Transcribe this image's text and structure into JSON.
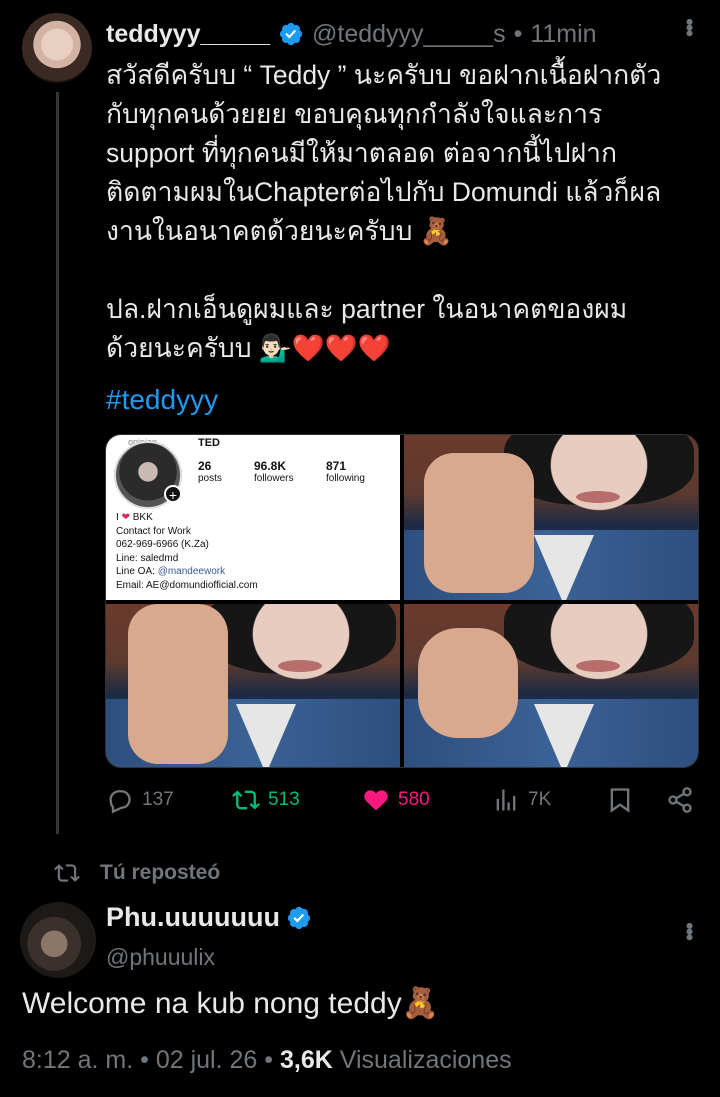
{
  "tweet": {
    "author_name": "teddyyy_____",
    "author_handle": "@teddyyy_____s",
    "separator": "•",
    "time": "11min",
    "text": "สวัสดีครับบ “ Teddy ” นะครับบ ขอฝากเนื้อฝากตัว\nกับทุกคนด้วยยย ขอบคุณทุกกำลังใจและการ\nsupport ที่ทุกคนมีให้มาตลอด ต่อจากนี้ไปฝาก\nติดตามผมในChapterต่อไปกับ Domundi แล้วก็ผล\nงานในอนาคตด้วยนะครับบ 🧸\n\nปล.ฝากเอ็นดูผมและ partner ในอนาคตของผม\nด้วยนะครับบ 💁🏻‍♂️❤️❤️❤️",
    "hashtag": "#teddyyy",
    "actions": {
      "replies": "137",
      "reposts": "513",
      "likes": "580",
      "views": "7K"
    },
    "colors": {
      "repost": "#00ba7c",
      "like": "#f91880",
      "link": "#1d9bf0"
    }
  },
  "instagram_card": {
    "username": "opinion...",
    "name": "TED",
    "posts_count": "26",
    "posts_label": "posts",
    "followers_count": "96.8K",
    "followers_label": "followers",
    "following_count": "871",
    "following_label": "following",
    "bio_line1_prefix": "I",
    "bio_line1_suffix": "BKK",
    "bio_line2": "Contact for Work",
    "bio_line3": "062-969-6966 (K.Za)",
    "bio_line4": "Line: saledmd",
    "bio_line5_label": "Line OA:",
    "bio_line5_link": "@mandeework",
    "bio_line6": "Email: AE@domundiofficial.com"
  },
  "repost_banner": {
    "text": "Tú reposteó"
  },
  "reply": {
    "author_name": "Phu.uuuuuuu",
    "author_handle": "@phuuulix",
    "text": "Welcome na kub nong teddy🧸",
    "time": "8:12 a. m.",
    "date": "02 jul. 26",
    "views_count": "3,6K",
    "views_label": "Visualizaciones",
    "separator": "•"
  }
}
